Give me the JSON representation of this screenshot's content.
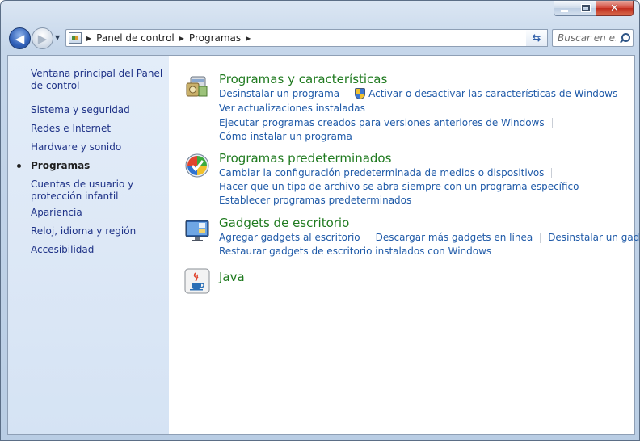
{
  "window": {
    "caption_buttons": {
      "minimize": "minimize",
      "maximize": "maximize",
      "close": "✕"
    }
  },
  "nav": {
    "back_icon": "◀",
    "forward_icon": "▶",
    "breadcrumb": [
      "Panel de control",
      "Programas"
    ],
    "search_placeholder": "Buscar en e...",
    "refresh_icon": "⇆"
  },
  "sidebar": {
    "items": [
      {
        "label": "Ventana principal del Panel de control",
        "current": false
      },
      {
        "label": "Sistema y seguridad",
        "current": false
      },
      {
        "label": "Redes e Internet",
        "current": false
      },
      {
        "label": "Hardware y sonido",
        "current": false
      },
      {
        "label": "Programas",
        "current": true
      },
      {
        "label": "Cuentas de usuario y protección infantil",
        "current": false
      },
      {
        "label": "Apariencia",
        "current": false
      },
      {
        "label": "Reloj, idioma y región",
        "current": false
      },
      {
        "label": "Accesibilidad",
        "current": false
      }
    ]
  },
  "categories": [
    {
      "title": "Programas y características",
      "icon": "programs-features-icon",
      "links": [
        [
          "Desinstalar un programa",
          "Activar o desactivar las características de Windows"
        ],
        [
          "Ver actualizaciones instaladas"
        ],
        [
          "Ejecutar programas creados para versiones anteriores de Windows"
        ],
        [
          "Cómo instalar un programa"
        ]
      ]
    },
    {
      "title": "Programas predeterminados",
      "icon": "default-programs-icon",
      "links": [
        [
          "Cambiar la configuración predeterminada de medios o dispositivos"
        ],
        [
          "Hacer que un tipo de archivo se abra siempre con un programa específico"
        ],
        [
          "Establecer programas predeterminados"
        ]
      ]
    },
    {
      "title": "Gadgets de escritorio",
      "icon": "desktop-gadgets-icon",
      "links": [
        [
          "Agregar gadgets al escritorio",
          "Descargar más gadgets en línea",
          "Desinstalar un gadget"
        ],
        [
          "Restaurar gadgets de escritorio instalados con Windows"
        ]
      ]
    },
    {
      "title": "Java",
      "icon": "java-icon",
      "links": []
    }
  ],
  "colors": {
    "link": "#1f5aa8",
    "category_title": "#1f7a1f",
    "sidebar_link": "#1e3287"
  }
}
